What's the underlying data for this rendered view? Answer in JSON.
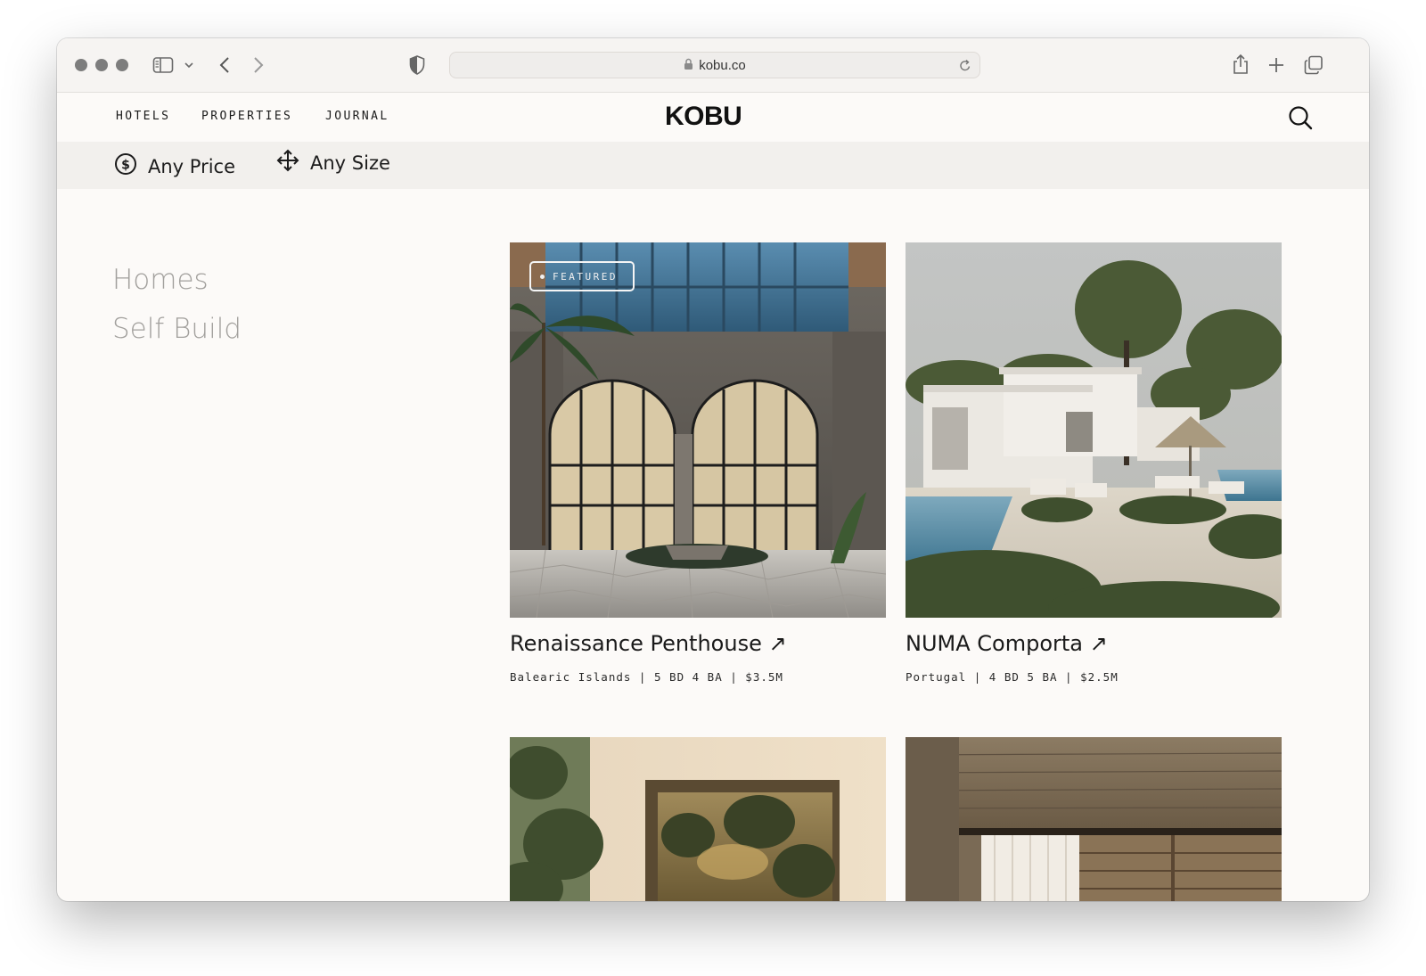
{
  "browser": {
    "url": "kobu.co",
    "icons": [
      "sidebar-toggle-icon",
      "chevron-down-icon",
      "back-icon",
      "forward-icon",
      "shield-icon",
      "lock-icon",
      "reload-icon",
      "share-icon",
      "new-tab-icon",
      "tabs-overview-icon"
    ]
  },
  "site": {
    "logo": "KOBU",
    "nav": [
      "HOTELS",
      "PROPERTIES",
      "JOURNAL"
    ]
  },
  "filters": {
    "price_label": "Any Price",
    "size_label": "Any Size"
  },
  "sidebar": {
    "items": [
      "Homes",
      "Self Build"
    ]
  },
  "listings": [
    {
      "title": "Renaissance Penthouse ↗",
      "meta": "Balearic Islands | 5 BD 4 BA | $3.5M",
      "badge": "FEATURED"
    },
    {
      "title": "NUMA Comporta ↗",
      "meta": "Portugal | 4 BD 5 BA | $2.5M"
    }
  ],
  "colors": {
    "page_bg": "#fcfaf8",
    "filter_bar_bg": "#f2f0ed",
    "sidebar_text": "#a2a09d"
  }
}
